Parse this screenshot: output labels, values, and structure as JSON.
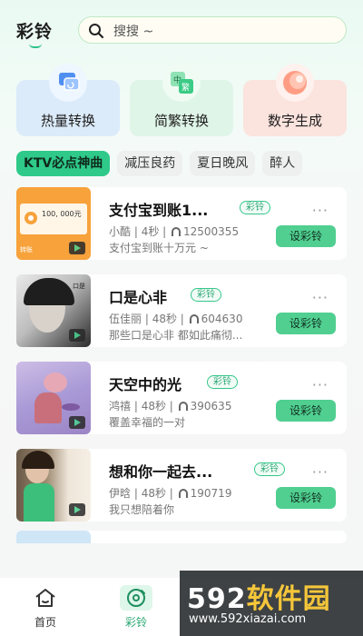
{
  "header": {
    "brand": "彩铃",
    "search_placeholder": "搜搜 ~"
  },
  "features": [
    {
      "label": "热量转换",
      "icon": "convert-icon"
    },
    {
      "label": "简繁转换",
      "icon": "chinese-convert-icon"
    },
    {
      "label": "数字生成",
      "icon": "digital-orb-icon"
    }
  ],
  "tags": [
    {
      "label": "KTV必点神曲",
      "active": true
    },
    {
      "label": "减压良药"
    },
    {
      "label": "夏日晚风"
    },
    {
      "label": "醉人"
    }
  ],
  "songs": [
    {
      "title": "支付宝到账1...",
      "badge": "彩铃",
      "artist": "小酷",
      "duration": "4秒",
      "plays": "12500355",
      "desc": "支付宝到账十万元 ~",
      "action": "设彩铃",
      "thumb_amount": "100, 000元",
      "thumb_label": "转账"
    },
    {
      "title": "口是心非",
      "badge": "彩铃",
      "artist": "伍佳丽",
      "duration": "48秒",
      "plays": "604630",
      "desc": "那些口是心非 都如此痛彻...",
      "action": "设彩铃",
      "thumb_side": "口是"
    },
    {
      "title": "天空中的光",
      "badge": "彩铃",
      "artist": "鸿禧",
      "duration": "48秒",
      "plays": "390635",
      "desc": "覆盖幸福的一对",
      "action": "设彩铃"
    },
    {
      "title": "想和你一起去...",
      "badge": "彩铃",
      "artist": "伊晗",
      "duration": "48秒",
      "plays": "190719",
      "desc": "我只想陪着你",
      "action": "设彩铃"
    }
  ],
  "nav": [
    {
      "label": "首页",
      "icon": "home-icon"
    },
    {
      "label": "彩铃",
      "icon": "ringtone-disc-icon",
      "active": true
    }
  ],
  "watermark": {
    "main_num": "592",
    "main_text": "软件园",
    "sub": "www.592xiazai.com"
  },
  "colors": {
    "accent": "#2fc98a",
    "badge": "#35c68a"
  }
}
